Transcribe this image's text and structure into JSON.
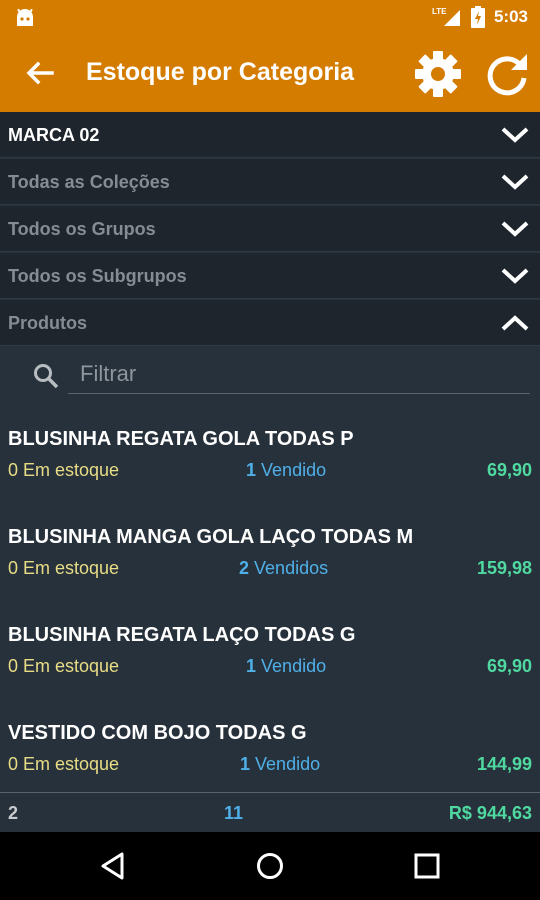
{
  "status_bar": {
    "network": "LTE",
    "time": "5:03"
  },
  "app_bar": {
    "title": "Estoque por Categoria",
    "color": "#d47c00"
  },
  "filters": [
    {
      "label": "MARCA 02",
      "active": true,
      "expanded": false
    },
    {
      "label": "Todas as Coleções",
      "active": false,
      "expanded": false
    },
    {
      "label": "Todos os Grupos",
      "active": false,
      "expanded": false
    },
    {
      "label": "Todos os Subgrupos",
      "active": false,
      "expanded": false
    },
    {
      "label": "Produtos",
      "active": false,
      "expanded": true
    }
  ],
  "search": {
    "placeholder": "Filtrar",
    "value": ""
  },
  "products": [
    {
      "name": "BLUSINHA  REGATA GOLA TODAS P",
      "stock": "0 Em estoque",
      "sold_count": "1",
      "sold_label": "Vendido",
      "price": "69,90"
    },
    {
      "name": "BLUSINHA MANGA GOLA LAÇO TODAS M",
      "stock": "0 Em estoque",
      "sold_count": "2",
      "sold_label": "Vendidos",
      "price": "159,98"
    },
    {
      "name": "BLUSINHA REGATA LAÇO TODAS G",
      "stock": "0 Em estoque",
      "sold_count": "1",
      "sold_label": "Vendido",
      "price": "69,90"
    },
    {
      "name": "VESTIDO COM BOJO TODAS G",
      "stock": "0 Em estoque",
      "sold_count": "1",
      "sold_label": "Vendido",
      "price": "144,99"
    }
  ],
  "footer": {
    "count": "2",
    "sold_total": "11",
    "total": "R$ 944,63"
  },
  "colors": {
    "accent": "#d47c00",
    "stock": "#e8dc85",
    "sold": "#4fb0e8",
    "price": "#4fd9a0"
  }
}
